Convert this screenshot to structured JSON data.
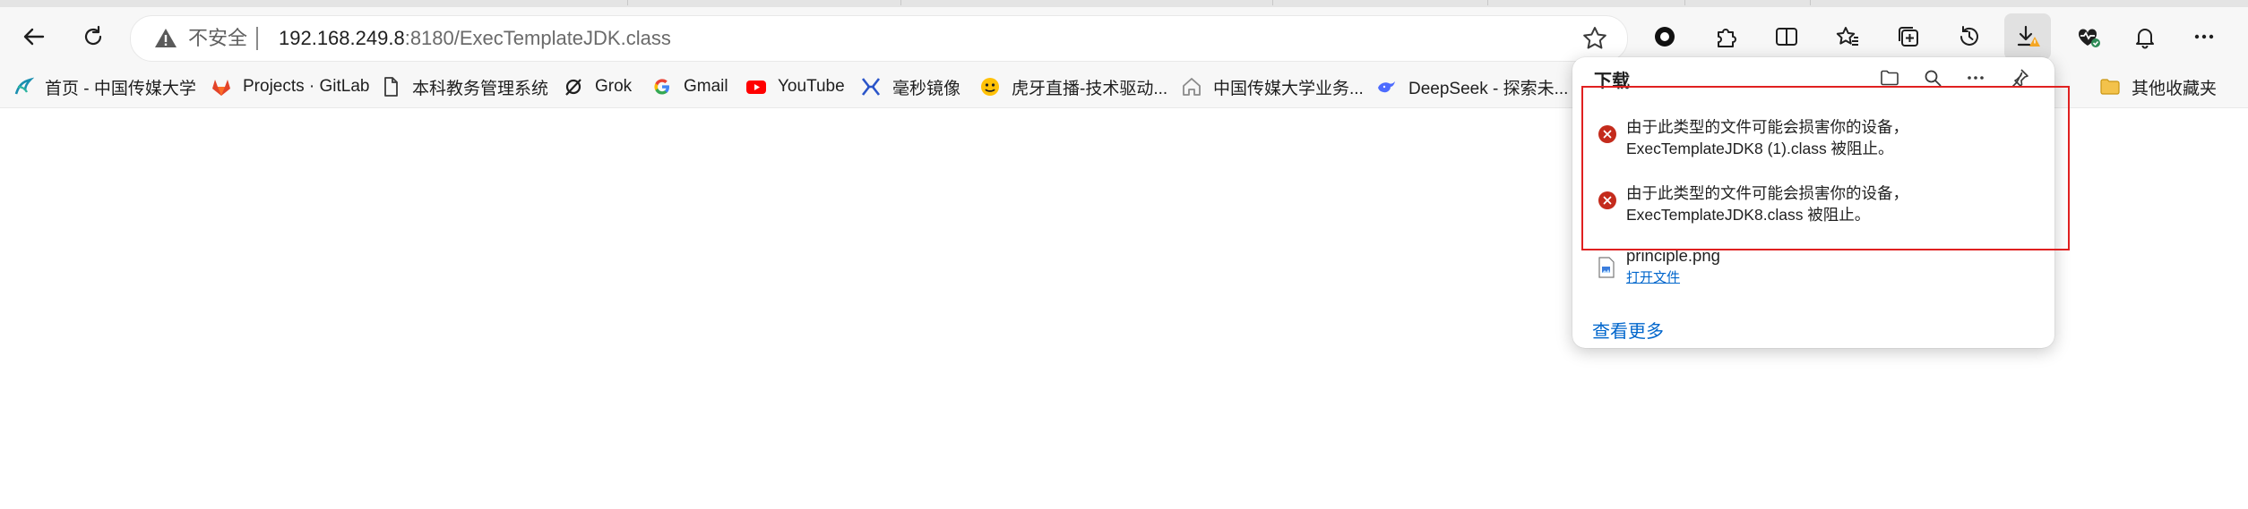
{
  "toolbar": {
    "security_label": "不安全",
    "url_host": "192.168.249.8",
    "url_rest": ":8180/ExecTemplateJDK.class"
  },
  "bookmarks": [
    {
      "label": "首页 - 中国传媒大学",
      "icon": "cuc-logo-icon"
    },
    {
      "label": "Projects · GitLab",
      "icon": "gitlab-icon"
    },
    {
      "label": "本科教务管理系统",
      "icon": "page-icon"
    },
    {
      "label": "Grok",
      "icon": "grok-icon"
    },
    {
      "label": "Gmail",
      "icon": "google-icon"
    },
    {
      "label": "YouTube",
      "icon": "youtube-icon"
    },
    {
      "label": "毫秒镜像",
      "icon": "mirror-logo-icon"
    },
    {
      "label": "虎牙直播-技术驱动...",
      "icon": "huya-icon"
    },
    {
      "label": "中国传媒大学业务...",
      "icon": "home-icon"
    },
    {
      "label": "DeepSeek - 探索未...",
      "icon": "deepseek-icon"
    }
  ],
  "other_favorites": "其他收藏夹",
  "downloads": {
    "title": "下载",
    "items": [
      {
        "line1": "由于此类型的文件可能会损害你的设备，",
        "line2": "ExecTemplateJDK8 (1).class 被阻止。"
      },
      {
        "line1": "由于此类型的文件可能会损害你的设备，",
        "line2": "ExecTemplateJDK8.class 被阻止。"
      }
    ],
    "file": {
      "name": "principle.png",
      "action": "打开文件"
    },
    "see_more": "查看更多"
  },
  "colors": {
    "error": "#c42b1c",
    "link": "#0066cc",
    "highlight": "#e02020",
    "warning": "#f5a623"
  }
}
